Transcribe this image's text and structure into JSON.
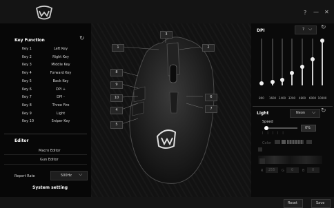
{
  "window": {
    "help": "?",
    "minimize": "—",
    "close": "✕"
  },
  "keyFunction": {
    "title": "Key Function",
    "keys": [
      {
        "key": "Key 1",
        "func": "Left Key"
      },
      {
        "key": "Key 2",
        "func": "Right Key"
      },
      {
        "key": "Key 3",
        "func": "Middle Key"
      },
      {
        "key": "Key 4",
        "func": "Forward Key"
      },
      {
        "key": "Key 5",
        "func": "Back Key"
      },
      {
        "key": "Key 6",
        "func": "DPI +"
      },
      {
        "key": "Key 7",
        "func": "DPI -"
      },
      {
        "key": "Key 8",
        "func": "Three Fire"
      },
      {
        "key": "Key 9",
        "func": "Light"
      },
      {
        "key": "Key 10",
        "func": "Sniper Key"
      }
    ]
  },
  "editor": {
    "title": "Editor",
    "macro": "Macro Editor",
    "gun": "Gun Editor"
  },
  "report": {
    "label": "Report Rate",
    "value": "500Hz"
  },
  "system": {
    "label": "System setting"
  },
  "mouseCallouts": [
    "1",
    "2",
    "3",
    "4",
    "5",
    "6",
    "7",
    "8",
    "9",
    "10"
  ],
  "dpi": {
    "title": "DPI",
    "selected": "7",
    "levels": [
      "800",
      "1600",
      "2400",
      "3200",
      "4800",
      "6000",
      "10000"
    ],
    "fractions": [
      0.05,
      0.08,
      0.12,
      0.26,
      0.4,
      0.56,
      0.95
    ]
  },
  "light": {
    "title": "Light",
    "mode": "Neon",
    "speedLabel": "Speed",
    "speedValue": "0%",
    "colorLabel": "Color",
    "r_label": "R",
    "r_value": "255",
    "g_label": "G",
    "g_value": "0",
    "b_label": "B",
    "b_value": "0"
  },
  "bottom": {
    "reset": "Reset",
    "save": "Save"
  },
  "icons": {
    "logo": "sven-logo",
    "refresh": "refresh-icon",
    "dropdown": "chevron-down-icon"
  }
}
